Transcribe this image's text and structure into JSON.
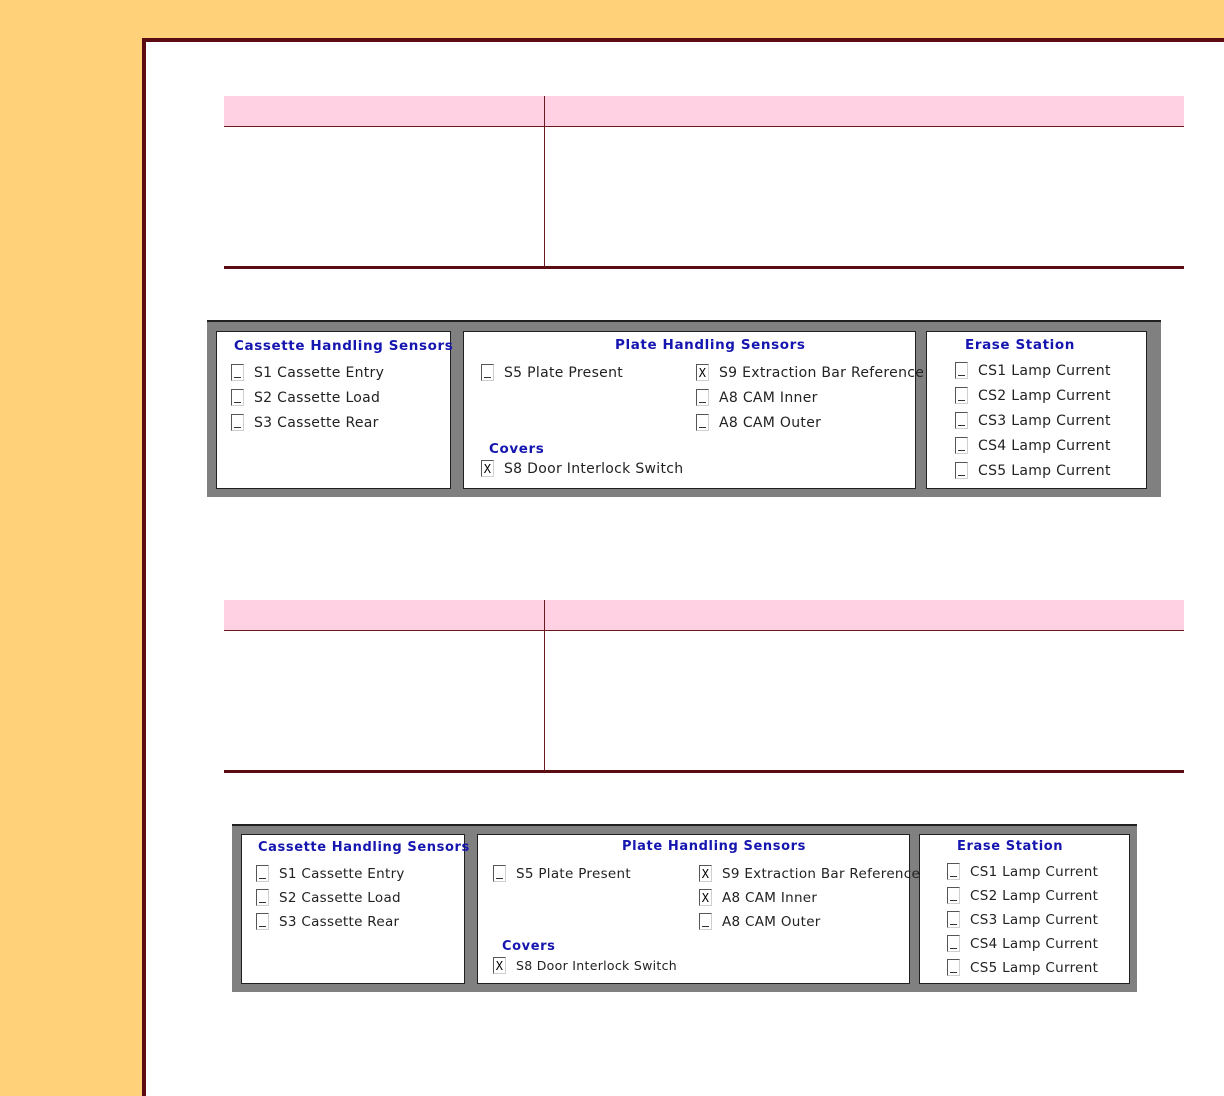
{
  "sensor_panels": [
    {
      "cassette": {
        "title": "Cassette Handling Sensors",
        "items": [
          {
            "label": "S1 Cassette Entry",
            "checked": false
          },
          {
            "label": "S2 Cassette Load",
            "checked": false
          },
          {
            "label": "S3 Cassette Rear",
            "checked": false
          }
        ]
      },
      "plate": {
        "title": "Plate Handling Sensors",
        "items": [
          {
            "label": "S5 Plate Present",
            "checked": false
          },
          {
            "label": "S9 Extraction Bar Reference",
            "checked": true,
            "mark": "X"
          },
          {
            "label": "A8 CAM Inner",
            "checked": false
          },
          {
            "label": "A8 CAM Outer",
            "checked": false
          }
        ],
        "covers_title": "Covers",
        "covers_items": [
          {
            "label": "S8 Door Interlock Switch",
            "checked": true,
            "mark": "X"
          }
        ]
      },
      "erase": {
        "title": "Erase Station",
        "items": [
          {
            "label": "CS1 Lamp Current",
            "checked": false
          },
          {
            "label": "CS2 Lamp Current",
            "checked": false
          },
          {
            "label": "CS3 Lamp Current",
            "checked": false
          },
          {
            "label": "CS4 Lamp Current",
            "checked": false
          },
          {
            "label": "CS5 Lamp Current",
            "checked": false
          }
        ]
      }
    },
    {
      "cassette": {
        "title": "Cassette Handling Sensors",
        "items": [
          {
            "label": "S1 Cassette Entry",
            "checked": false
          },
          {
            "label": "S2 Cassette Load",
            "checked": false
          },
          {
            "label": "S3 Cassette Rear",
            "checked": false
          }
        ]
      },
      "plate": {
        "title": "Plate Handling Sensors",
        "items": [
          {
            "label": "S5 Plate Present",
            "checked": false
          },
          {
            "label": "S9 Extraction Bar Reference",
            "checked": true,
            "mark": "X"
          },
          {
            "label": "A8 CAM Inner",
            "checked": true,
            "mark": "X"
          },
          {
            "label": "A8 CAM Outer",
            "checked": false
          }
        ],
        "covers_title": "Covers",
        "covers_items": [
          {
            "label": "S8 Door Interlock Switch",
            "checked": true,
            "mark": "X"
          }
        ]
      },
      "erase": {
        "title": "Erase Station",
        "items": [
          {
            "label": "CS1 Lamp Current",
            "checked": false
          },
          {
            "label": "CS2 Lamp Current",
            "checked": false
          },
          {
            "label": "CS3 Lamp Current",
            "checked": false
          },
          {
            "label": "CS4 Lamp Current",
            "checked": false
          },
          {
            "label": "CS5 Lamp Current",
            "checked": false
          }
        ]
      }
    }
  ],
  "colors": {
    "background": "#ffd27a",
    "frame": "#5a0c12",
    "table_header": "#ffd1e3",
    "group_title": "#1515b0",
    "panel": "#808080"
  }
}
